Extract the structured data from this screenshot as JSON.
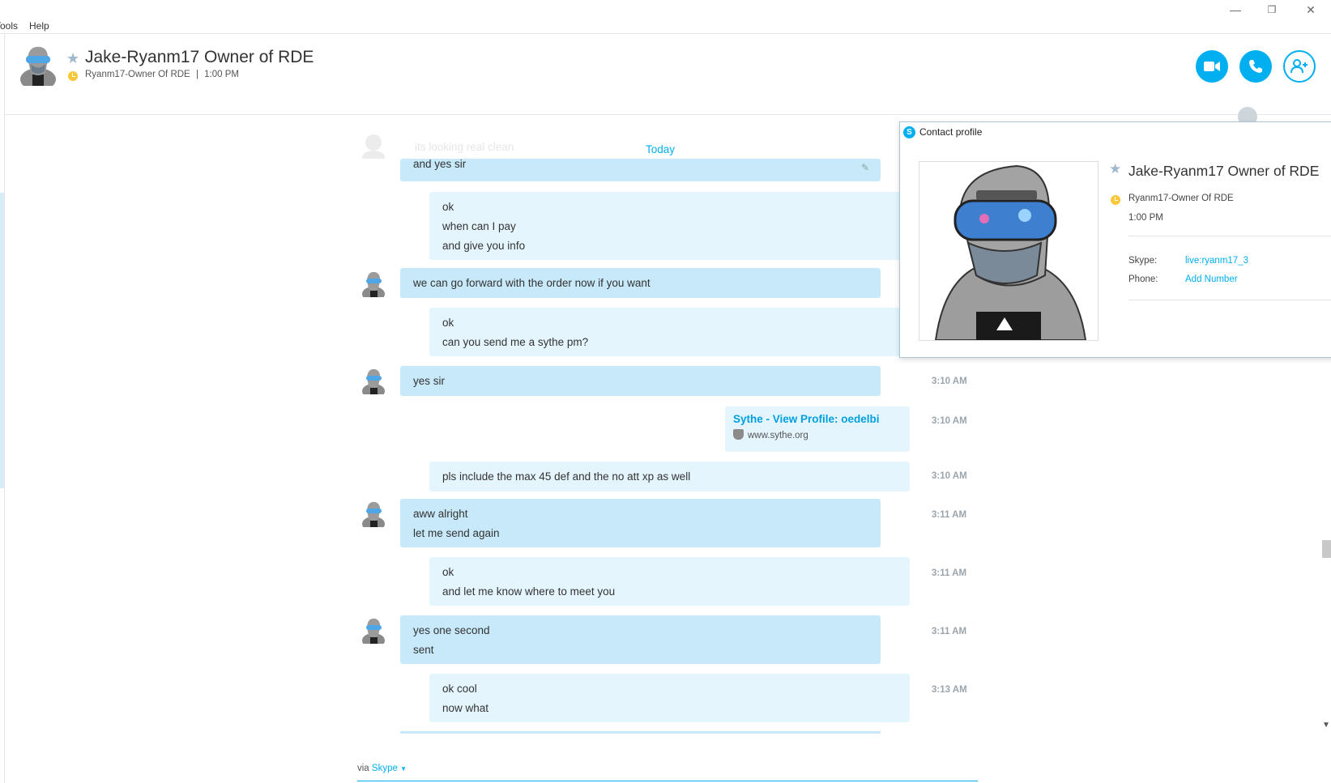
{
  "menu": {
    "tools": "Tools",
    "help": "Help"
  },
  "window_controls": {
    "minimize": "—",
    "restore": "❐",
    "close": "✕"
  },
  "header": {
    "name": "Jake-Ryanm17 Owner of RDE",
    "mood": "Ryanm17-Owner Of RDE",
    "separator": "|",
    "local_time": "1:00 PM"
  },
  "date_divider": "Today",
  "faded_message": "its looking real clean",
  "messages": [
    {
      "from": "them",
      "lines": [
        "and yes sir"
      ],
      "time": ""
    },
    {
      "from": "me",
      "lines": [
        "ok",
        "when can I pay",
        "and give you info"
      ],
      "time": ""
    },
    {
      "from": "them",
      "lines": [
        "we can go forward with the order now if you want"
      ],
      "time": ""
    },
    {
      "from": "me",
      "lines": [
        "ok",
        "can you send me a sythe pm?"
      ],
      "time": ""
    },
    {
      "from": "them",
      "lines": [
        "yes sir"
      ],
      "time": "3:10 AM"
    },
    {
      "from": "me-link",
      "lines": [
        "Sythe - View Profile: oedelbi",
        "www.sythe.org"
      ],
      "time": "3:10 AM"
    },
    {
      "from": "me",
      "lines": [
        "pls include the max 45 def and the no att xp as well"
      ],
      "time": "3:10 AM"
    },
    {
      "from": "them",
      "lines": [
        "aww alright",
        "let me send again"
      ],
      "time": "3:11 AM"
    },
    {
      "from": "me",
      "lines": [
        "ok",
        "and let me know where to meet you"
      ],
      "time": "3:11 AM"
    },
    {
      "from": "them",
      "lines": [
        "yes one second",
        "sent"
      ],
      "time": "3:11 AM"
    },
    {
      "from": "me",
      "lines": [
        "ok cool",
        "now what"
      ],
      "time": "3:13 AM"
    }
  ],
  "composer": {
    "via": "via",
    "service": "Skype"
  },
  "profile": {
    "title": "Contact profile",
    "name": "Jake-Ryanm17 Owner of RDE",
    "mood": "Ryanm17-Owner Of RDE",
    "local_time": "1:00 PM",
    "skype_label": "Skype:",
    "skype_value": "live:ryanm17_3",
    "phone_label": "Phone:",
    "phone_value": "Add Number"
  },
  "colors": {
    "accent": "#00aff0",
    "bubble_them": "#c7e9f9",
    "bubble_me": "#e4f5fd",
    "status_away": "#f8c73a"
  }
}
